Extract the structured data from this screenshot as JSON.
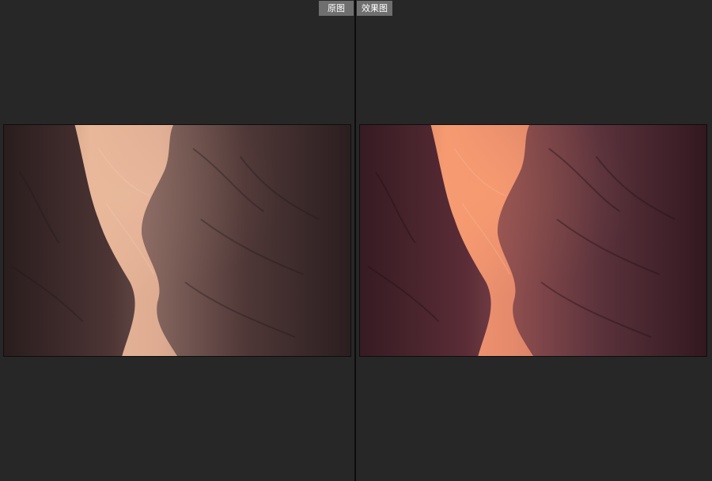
{
  "tabs": {
    "before_label": "原图",
    "after_label": "效果图"
  },
  "colors": {
    "background": "#272727",
    "divider": "#0c0c0c",
    "tab_background": "#6f6f6f",
    "tab_text": "#ffffff"
  },
  "images": {
    "before": {
      "icon": "canyon-rock-photo",
      "rock_light": "#e9b49a",
      "rock_dark": "#2f1f20"
    },
    "after": {
      "icon": "canyon-rock-photo-edited",
      "rock_light": "#f59468",
      "rock_dark": "#3d1f26"
    }
  }
}
